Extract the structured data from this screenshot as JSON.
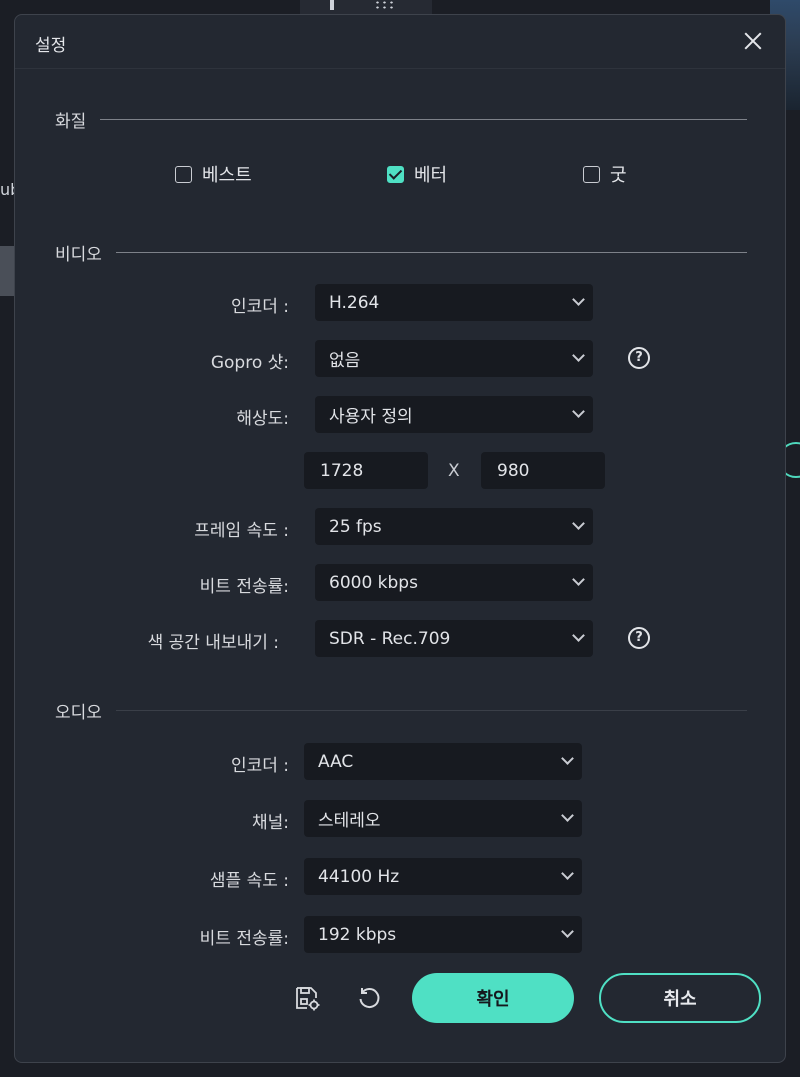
{
  "background": {
    "left_text": "ub"
  },
  "dialog": {
    "title": "설정",
    "close_icon": "close-icon"
  },
  "quality": {
    "heading": "화질",
    "options": [
      {
        "label": "베스트",
        "checked": false
      },
      {
        "label": "베터",
        "checked": true
      },
      {
        "label": "굿",
        "checked": false
      }
    ]
  },
  "video": {
    "heading": "비디오",
    "encoder_label": "인코더 :",
    "encoder_value": "H.264",
    "gopro_label": "Gopro 샷:",
    "gopro_value": "없음",
    "resolution_label": "해상도:",
    "resolution_value": "사용자 정의",
    "width": "1728",
    "height": "980",
    "x_separator": "X",
    "framerate_label": "프레임 속도 :",
    "framerate_value": "25 fps",
    "bitrate_label": "비트 전송률:",
    "bitrate_value": "6000 kbps",
    "colorspace_label": "색 공간 내보내기 :",
    "colorspace_value": "SDR - Rec.709",
    "help_icon": "?"
  },
  "audio": {
    "heading": "오디오",
    "encoder_label": "인코더 :",
    "encoder_value": "AAC",
    "channel_label": "채널:",
    "channel_value": "스테레오",
    "samplerate_label": "샘플 속도 :",
    "samplerate_value": "44100 Hz",
    "bitrate_label": "비트 전송률:",
    "bitrate_value": "192 kbps"
  },
  "footer": {
    "save_preset_icon": "save-preset-icon",
    "reset_icon": "reset-icon",
    "ok_label": "확인",
    "cancel_label": "취소"
  },
  "colors": {
    "accent": "#4fe0c4",
    "dialog_bg": "#232831",
    "field_bg": "#171a20"
  }
}
